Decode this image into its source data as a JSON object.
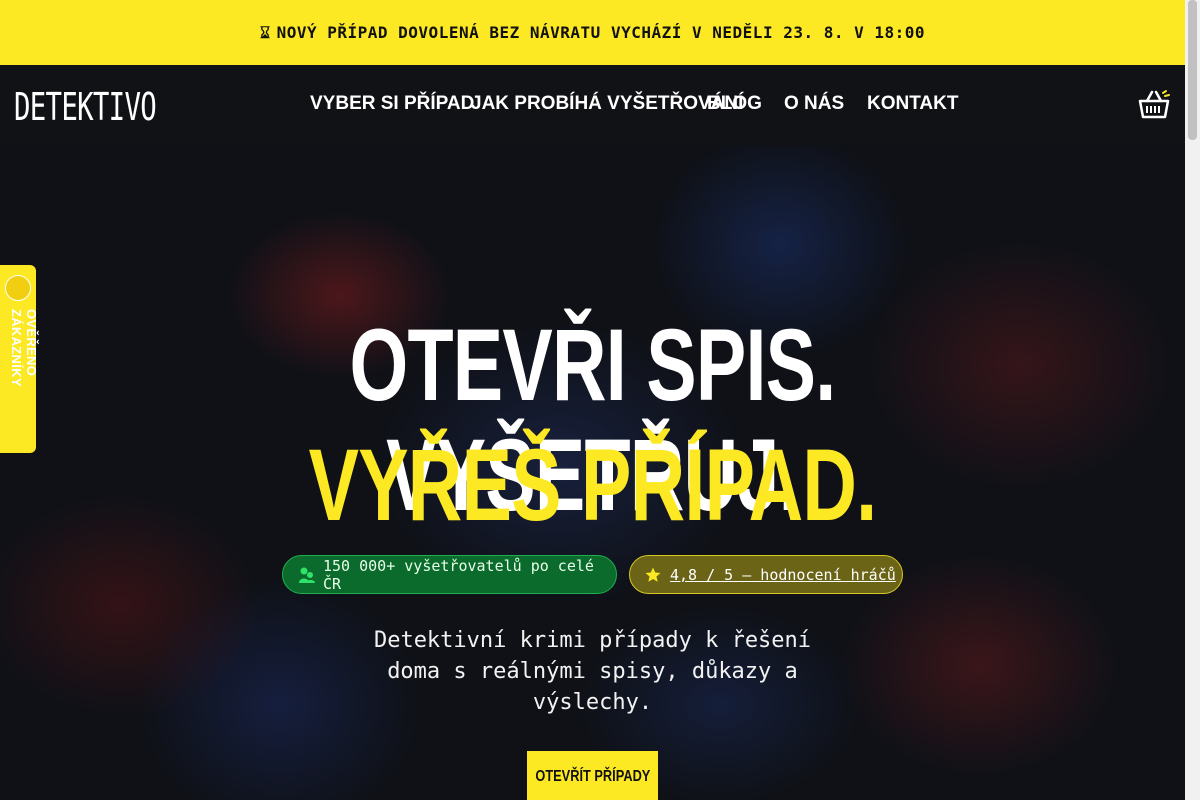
{
  "announcement": {
    "icon": "hourglass-icon",
    "text": "NOVÝ PŘÍPAD DOVOLENÁ BEZ NÁVRATU VYCHÁZÍ V NEDĚLI 23. 8. V 18:00"
  },
  "header": {
    "logo_text": "DETEKTIVO",
    "nav": [
      {
        "label": "VYBER SI PŘÍPAD"
      },
      {
        "label": "JAK PROBÍHÁ VYŠETŘOVÁNÍ"
      },
      {
        "label": "BLOG"
      },
      {
        "label": "O NÁS"
      },
      {
        "label": "KONTAKT"
      }
    ],
    "cart_icon": "shopping-basket-icon"
  },
  "hero": {
    "headline_white": "OTEVŘI SPIS. VYŠETŘUJ.",
    "headline_yellow": "VYŘEŠ PŘÍPAD.",
    "pill_players": {
      "icon": "players-icon",
      "text": "150 000+ vyšetřovatelů po celé ČR"
    },
    "pill_rating": {
      "icon": "star-icon",
      "text": "4,8 / 5 — hodnocení hráčů"
    },
    "subtitle": "Detektivní krimi případy k řešení doma s reálnými spisy, důkazy a výslechy.",
    "cta_label": "OTEVŘÍT PŘÍPADY"
  },
  "side_badge": {
    "text": "OVĚŘENO ZÁKAZNÍKY"
  },
  "colors": {
    "accent_yellow": "#fde923",
    "header_bg": "#111216",
    "pill_green": "#0a6b2c",
    "pill_yellow": "#6b6417"
  }
}
